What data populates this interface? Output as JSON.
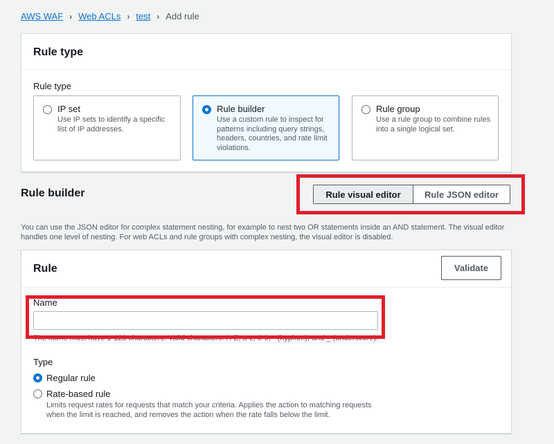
{
  "breadcrumb": {
    "items": [
      "AWS WAF",
      "Web ACLs",
      "test"
    ],
    "current": "Add rule"
  },
  "rule_type_panel": {
    "title": "Rule type",
    "label": "Rule type",
    "options": [
      {
        "title": "IP set",
        "desc1": "Use IP sets to identify a specific",
        "desc2": "list of IP addresses.",
        "desc3": "",
        "desc4": "",
        "selected": false
      },
      {
        "title": "Rule builder",
        "desc1": "Use a custom rule to inspect for",
        "desc2": "patterns including query strings,",
        "desc3": "headers, countries, and rate limit",
        "desc4": "violations.",
        "selected": true
      },
      {
        "title": "Rule group",
        "desc1": "Use a rule group to combine rules",
        "desc2": "into a single logical set.",
        "desc3": "",
        "desc4": "",
        "selected": false
      }
    ]
  },
  "rule_builder": {
    "title": "Rule builder",
    "visual_editor": "Rule visual editor",
    "json_editor": "Rule JSON editor",
    "help1": "You can use the JSON editor for complex statement nesting, for example to nest two OR statements inside an AND statement. The visual editor",
    "help2": "handles one level of nesting. For web ACLs and rule groups with complex nesting, the visual editor is disabled."
  },
  "rule_panel": {
    "title": "Rule",
    "validate": "Validate",
    "name_label": "Name",
    "name_value": "",
    "name_hint": "The name must have 1-128 characters. Valid characters: A-Z, a-z, 0-9, - (hyphen), and _ (underscore).",
    "type_label": "Type",
    "regular": "Regular rule",
    "rate_based": "Rate-based rule",
    "rate_desc1": "Limits request rates for requests that match your criteria. Applies the action to matching requests",
    "rate_desc2": "when the limit is reached, and removes the action when the rate falls below the limit."
  },
  "colors": {
    "link": "#0972d3",
    "highlight": "#e01e2b",
    "selected_bg": "#f1faff"
  }
}
